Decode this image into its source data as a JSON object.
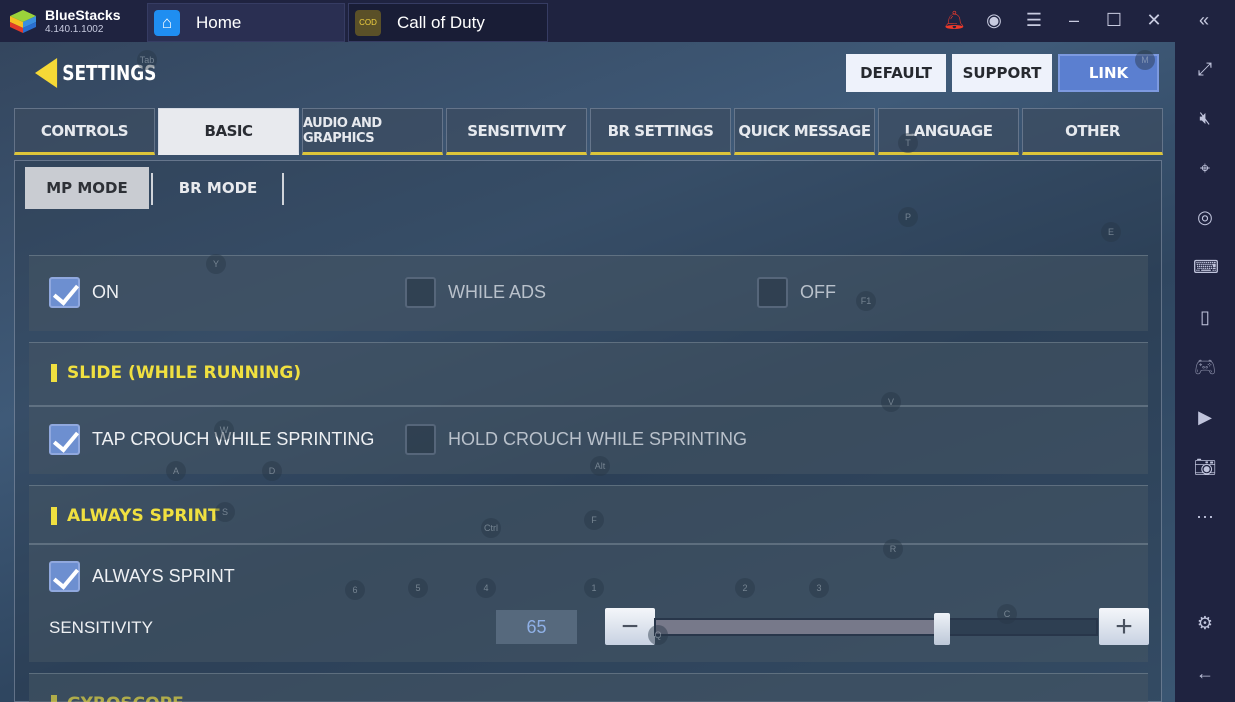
{
  "app": {
    "name": "BlueStacks",
    "version": "4.140.1.1002"
  },
  "tabs": [
    {
      "label": "Home",
      "icon": "home-icon"
    },
    {
      "label": "Call of Duty",
      "icon": "call-of-duty-icon"
    }
  ],
  "window_controls": [
    "bell-icon",
    "account-icon",
    "menu-icon",
    "minimize-icon",
    "maximize-icon",
    "close-icon",
    "collapse-sidebar-icon"
  ],
  "sidebar": [
    "fullscreen-icon",
    "mute-icon",
    "pointer-lock-icon",
    "eye-icon",
    "keyboard-icon",
    "portrait-icon",
    "gamepad-icon",
    "media-manager-icon",
    "camera-icon",
    "more-icon",
    "settings-icon",
    "back-icon"
  ],
  "game": {
    "title": "SETTINGS",
    "buttons": {
      "default": "DEFAULT",
      "support": "SUPPORT",
      "link": "LINK"
    },
    "main_tabs": [
      "CONTROLS",
      "BASIC",
      "AUDIO AND GRAPHICS",
      "SENSITIVITY",
      "BR SETTINGS",
      "QUICK MESSAGE",
      "LANGUAGE",
      "OTHER"
    ],
    "active_main_tab": "BASIC",
    "sub_tabs": [
      "MP MODE",
      "BR MODE"
    ],
    "active_sub_tab": "MP MODE",
    "ads_options": [
      {
        "label": "ON",
        "checked": true
      },
      {
        "label": "WHILE ADS",
        "checked": false
      },
      {
        "label": "OFF",
        "checked": false
      }
    ],
    "slide": {
      "header": "SLIDE (WHILE RUNNING)",
      "options": [
        {
          "label": "TAP CROUCH WHILE SPRINTING",
          "checked": true
        },
        {
          "label": "HOLD CROUCH WHILE SPRINTING",
          "checked": false
        }
      ]
    },
    "sprint": {
      "header": "ALWAYS SPRINT",
      "option": {
        "label": "ALWAYS SPRINT",
        "checked": true
      },
      "sensitivity_label": "SENSITIVITY",
      "sensitivity_value": "65",
      "slider_percent": 65
    },
    "gyroscope": {
      "header": "GYROSCOPE"
    },
    "key_hints": [
      "Tab",
      "M",
      "T",
      "P",
      "E",
      "Y",
      "F1",
      "V",
      "W",
      "A",
      "D",
      "S",
      "Alt",
      "Ctrl",
      "F",
      "R",
      "6",
      "5",
      "4",
      "1",
      "2",
      "3",
      "C",
      "Q"
    ]
  },
  "colors": {
    "accent_yellow": "#f0e040",
    "link_blue": "#5b7fd0",
    "titlebar": "#1f2340"
  }
}
